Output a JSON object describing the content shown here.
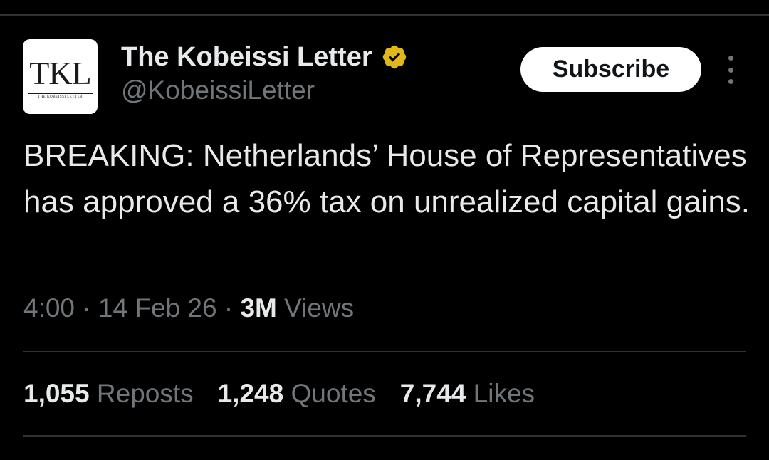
{
  "author": {
    "avatar_text": "TKL",
    "avatar_subtext": "THE KOBEISSI LETTER",
    "display_name": "The Kobeissi Letter",
    "handle": "@KobeissiLetter",
    "verified_icon": "verified-badge-gold"
  },
  "actions": {
    "subscribe_label": "Subscribe",
    "more_icon": "more-vertical-icon"
  },
  "tweet": {
    "text": "BREAKING: Netherlands’ House of Representatives has approved a 36% tax on unrealized capital gains.",
    "time": "4:00",
    "date": "14 Feb 26",
    "separator": "·",
    "views_count": "3M",
    "views_label": "Views"
  },
  "stats": {
    "reposts_count": "1,055",
    "reposts_label": "Reposts",
    "quotes_count": "1,248",
    "quotes_label": "Quotes",
    "likes_count": "7,744",
    "likes_label": "Likes"
  },
  "colors": {
    "background": "#000000",
    "text_primary": "#e7e9ea",
    "text_secondary": "#71767b",
    "divider": "#2f3336",
    "verified_gold": "#e2b719"
  }
}
